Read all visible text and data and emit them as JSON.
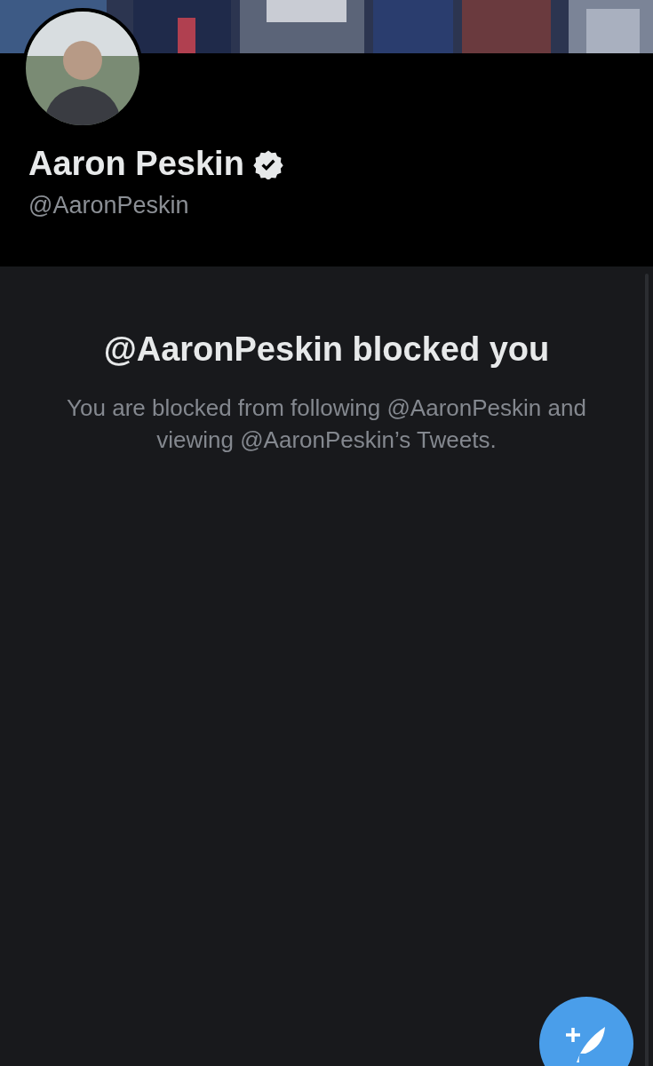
{
  "profile": {
    "name": "Aaron Peskin",
    "verified": true,
    "handle": "@AaronPeskin"
  },
  "blocked_notice": {
    "title": "@AaronPeskin blocked you",
    "message": "You are blocked from following @AaronPeskin and viewing @AaronPeskin’s Tweets."
  }
}
